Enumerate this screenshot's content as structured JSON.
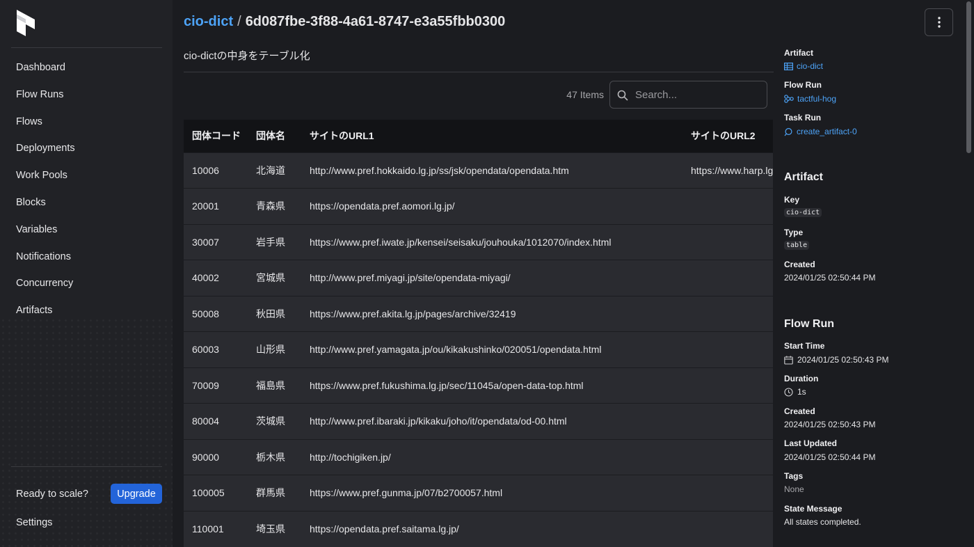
{
  "sidebar": {
    "nav": [
      "Dashboard",
      "Flow Runs",
      "Flows",
      "Deployments",
      "Work Pools",
      "Blocks",
      "Variables",
      "Notifications",
      "Concurrency",
      "Artifacts"
    ],
    "ready_text": "Ready to scale?",
    "upgrade_label": "Upgrade",
    "settings_label": "Settings"
  },
  "header": {
    "breadcrumb_link": "cio-dict",
    "breadcrumb_separator": "/",
    "artifact_id": "6d087fbe-3f88-4a61-8747-e3a55fbb0300"
  },
  "description": "cio-dictの中身をテーブル化",
  "toolbar": {
    "items_count": "47 Items",
    "search_placeholder": "Search..."
  },
  "table": {
    "headers": [
      "団体コード",
      "団体名",
      "サイトのURL1",
      "サイトのURL2"
    ],
    "rows": [
      [
        "10006",
        "北海道",
        "http://www.pref.hokkaido.lg.jp/ss/jsk/opendata/opendata.htm",
        "https://www.harp.lg.jp/"
      ],
      [
        "20001",
        "青森県",
        "https://opendata.pref.aomori.lg.jp/",
        ""
      ],
      [
        "30007",
        "岩手県",
        "https://www.pref.iwate.jp/kensei/seisaku/jouhouka/1012070/index.html",
        ""
      ],
      [
        "40002",
        "宮城県",
        "http://www.pref.miyagi.jp/site/opendata-miyagi/",
        ""
      ],
      [
        "50008",
        "秋田県",
        "https://www.pref.akita.lg.jp/pages/archive/32419",
        ""
      ],
      [
        "60003",
        "山形県",
        "http://www.pref.yamagata.jp/ou/kikakushinko/020051/opendata.html",
        ""
      ],
      [
        "70009",
        "福島県",
        "https://www.pref.fukushima.lg.jp/sec/11045a/open-data-top.html",
        ""
      ],
      [
        "80004",
        "茨城県",
        "http://www.pref.ibaraki.jp/kikaku/joho/it/opendata/od-00.html",
        ""
      ],
      [
        "90000",
        "栃木県",
        "http://tochigiken.jp/",
        ""
      ],
      [
        "100005",
        "群馬県",
        "https://www.pref.gunma.jp/07/b2700057.html",
        ""
      ],
      [
        "110001",
        "埼玉県",
        "https://opendata.pref.saitama.lg.jp/",
        ""
      ]
    ]
  },
  "details": {
    "artifact_label": "Artifact",
    "artifact_link": "cio-dict",
    "flow_run_label": "Flow Run",
    "flow_run_link": "tactful-hog",
    "task_run_label": "Task Run",
    "task_run_link": "create_artifact-0",
    "artifact_section": "Artifact",
    "key_label": "Key",
    "key_value": "cio-dict",
    "type_label": "Type",
    "type_value": "table",
    "created_label": "Created",
    "created_value": "2024/01/25 02:50:44 PM",
    "flow_run_section": "Flow Run",
    "start_time_label": "Start Time",
    "start_time_value": "2024/01/25 02:50:43 PM",
    "duration_label": "Duration",
    "duration_value": "1s",
    "fr_created_label": "Created",
    "fr_created_value": "2024/01/25 02:50:43 PM",
    "last_updated_label": "Last Updated",
    "last_updated_value": "2024/01/25 02:50:44 PM",
    "tags_label": "Tags",
    "tags_value": "None",
    "state_message_label": "State Message",
    "state_message_value": "All states completed."
  },
  "colors": {
    "accent_link": "#4da3f7",
    "upgrade_button": "#2364d9",
    "background": "#1b1c20",
    "sidebar": "#212226"
  }
}
